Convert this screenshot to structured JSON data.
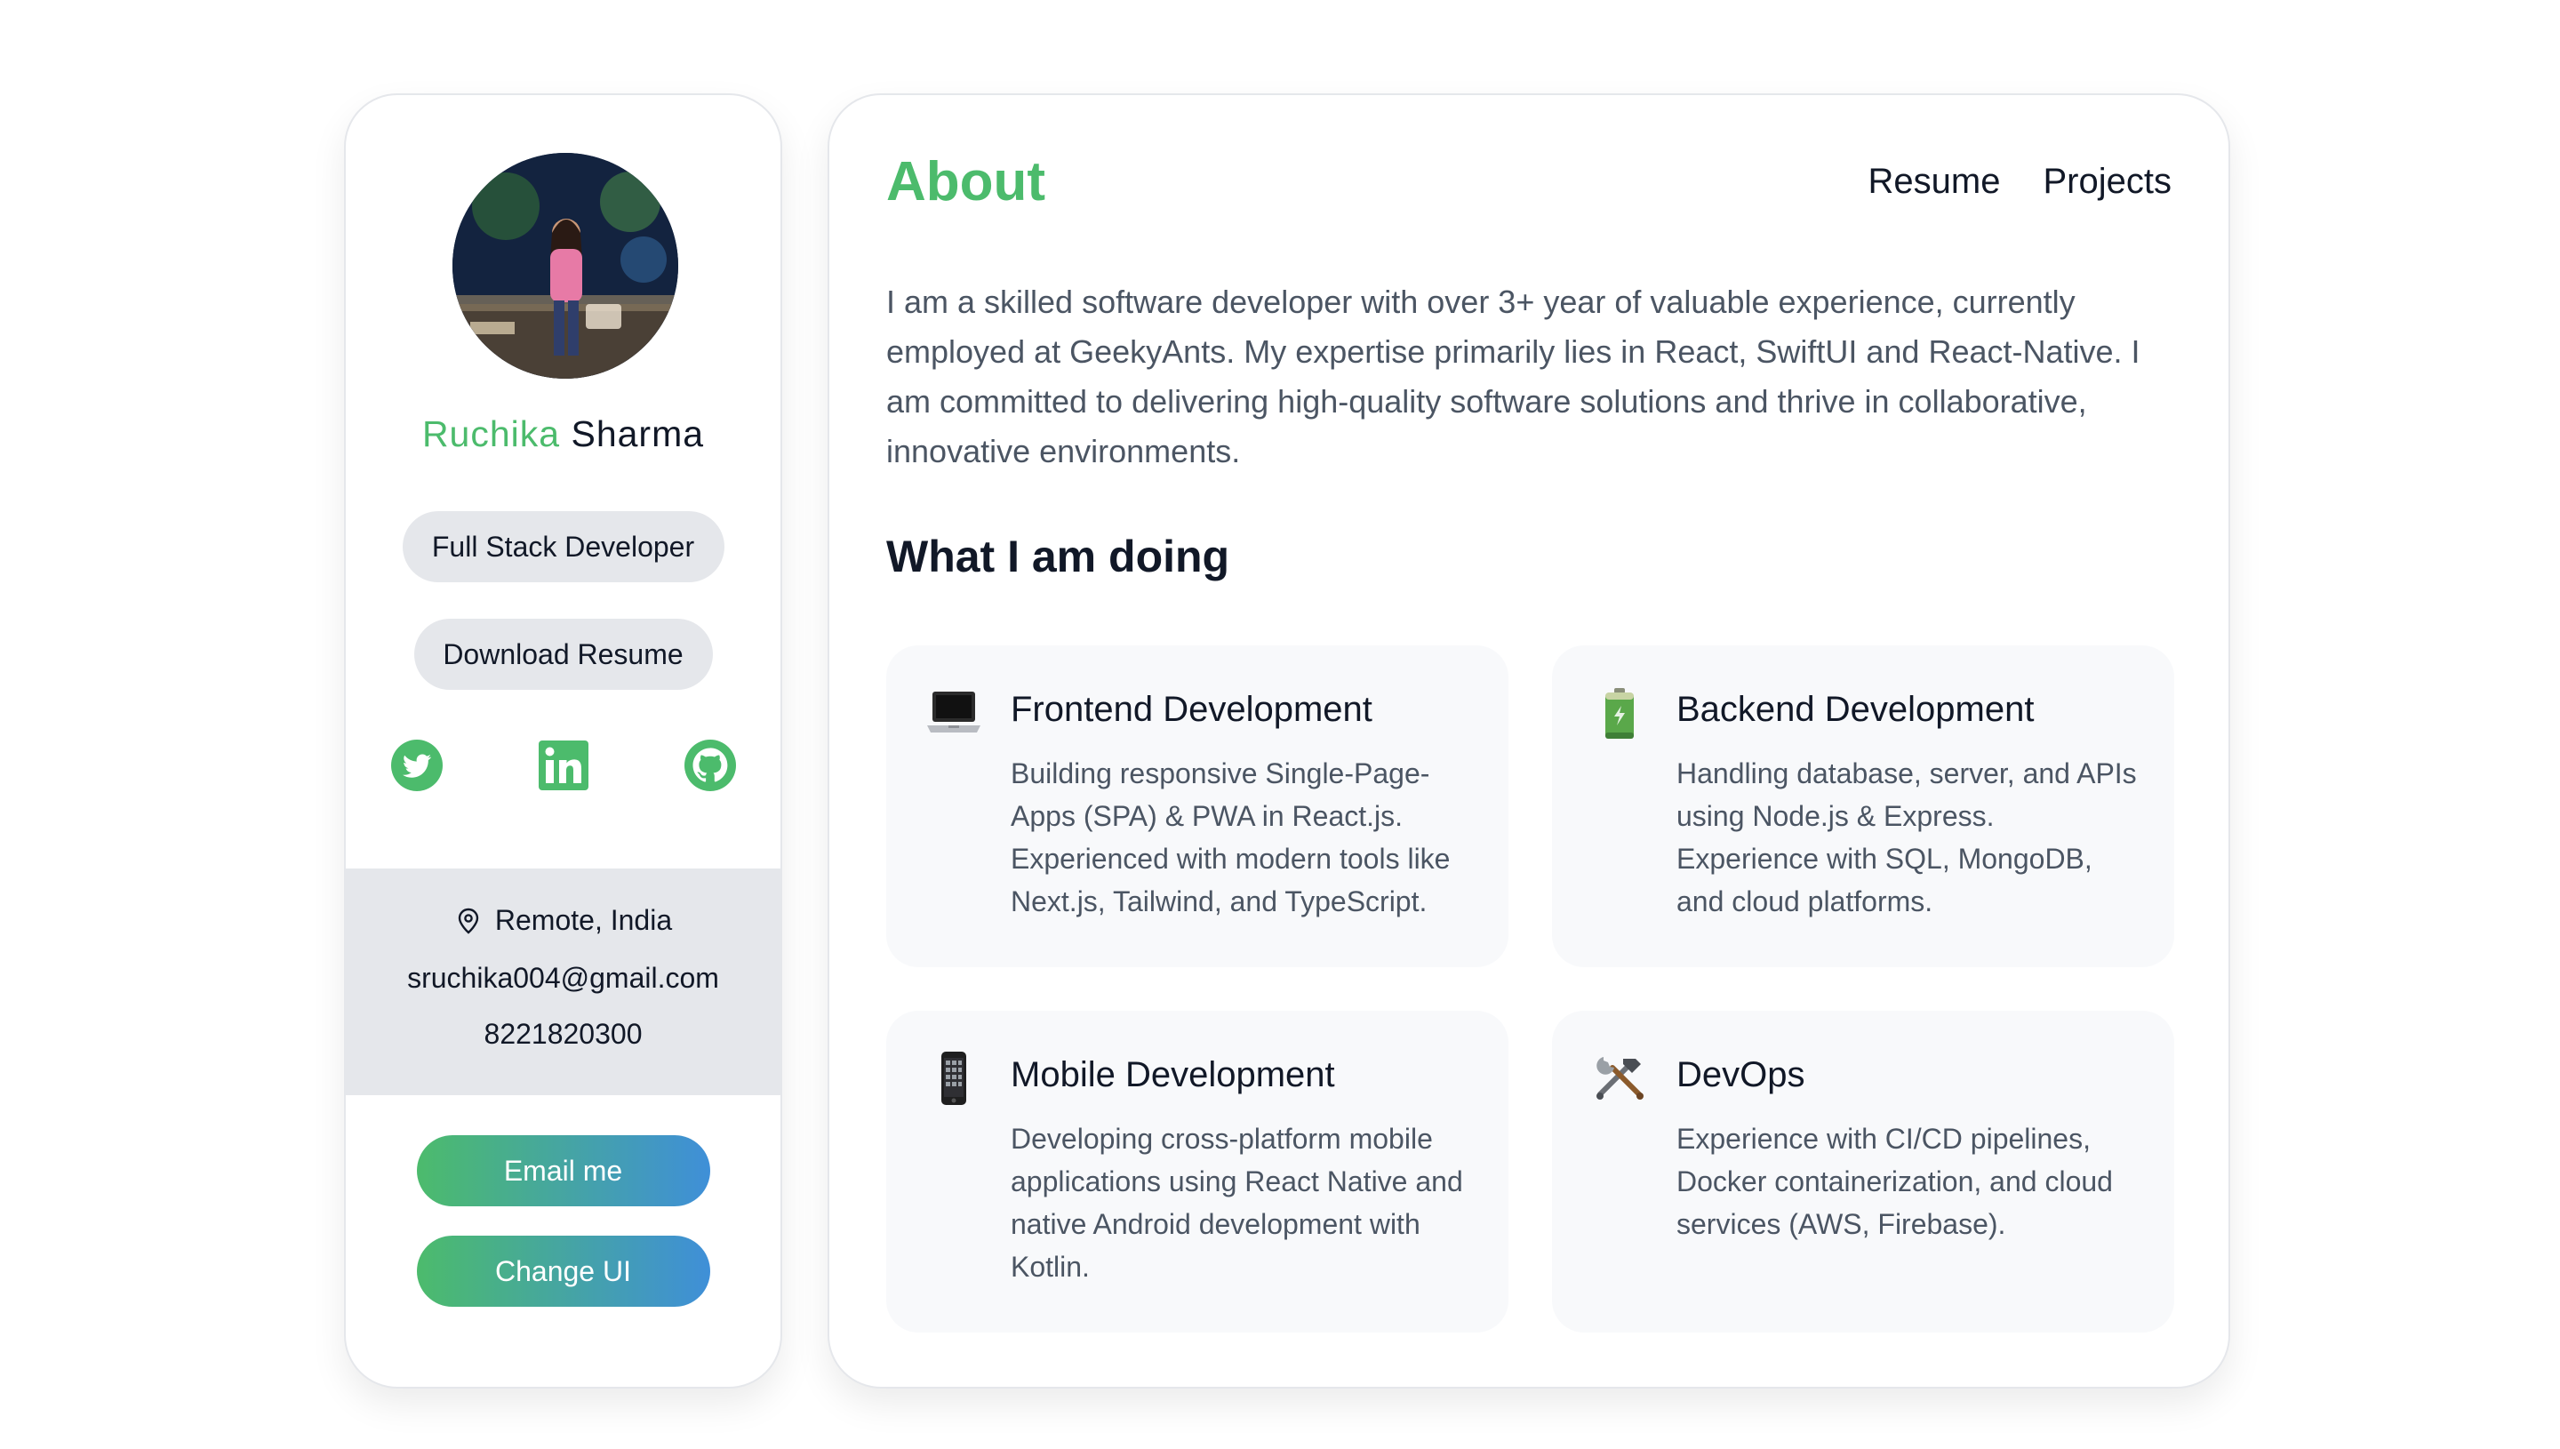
{
  "profile": {
    "first_name": "Ruchika",
    "last_name": "Sharma",
    "role": "Full Stack Developer",
    "download_label": "Download Resume",
    "location": "Remote, India",
    "email": "sruchika004@gmail.com",
    "phone": "8221820300",
    "email_button": "Email me",
    "change_ui_button": "Change UI",
    "socials": [
      "twitter-icon",
      "linkedin-icon",
      "github-icon"
    ]
  },
  "main": {
    "title": "About",
    "nav": [
      "Resume",
      "Projects"
    ],
    "about": "I am a skilled software developer with over 3+ year of valuable experience, currently employed at GeekyAnts. My expertise primarily lies in React, SwiftUI and React-Native. I am committed to delivering high-quality software solutions and thrive in collaborative, innovative environments.",
    "section_title": "What I am doing",
    "services": [
      {
        "icon": "laptop-icon",
        "title": "Frontend Development",
        "description": "Building responsive Single-Page-Apps (SPA) & PWA in React.js. Experienced with modern tools like Next.js, Tailwind, and TypeScript."
      },
      {
        "icon": "battery-icon",
        "title": "Backend Development",
        "description": "Handling database, server, and APIs using Node.js & Express. Experience with SQL, MongoDB, and cloud platforms."
      },
      {
        "icon": "mobile-phone-icon",
        "title": "Mobile Development",
        "description": "Developing cross-platform mobile applications using React Native and native Android development with Kotlin."
      },
      {
        "icon": "tools-icon",
        "title": "DevOps",
        "description": "Experience with CI/CD pipelines, Docker containerization, and cloud services (AWS, Firebase)."
      }
    ]
  },
  "colors": {
    "accent": "#4cbb6c",
    "gradient_end": "#3f8fd8",
    "pill_bg": "#e5e7eb",
    "card_bg": "#f8f9fb"
  }
}
